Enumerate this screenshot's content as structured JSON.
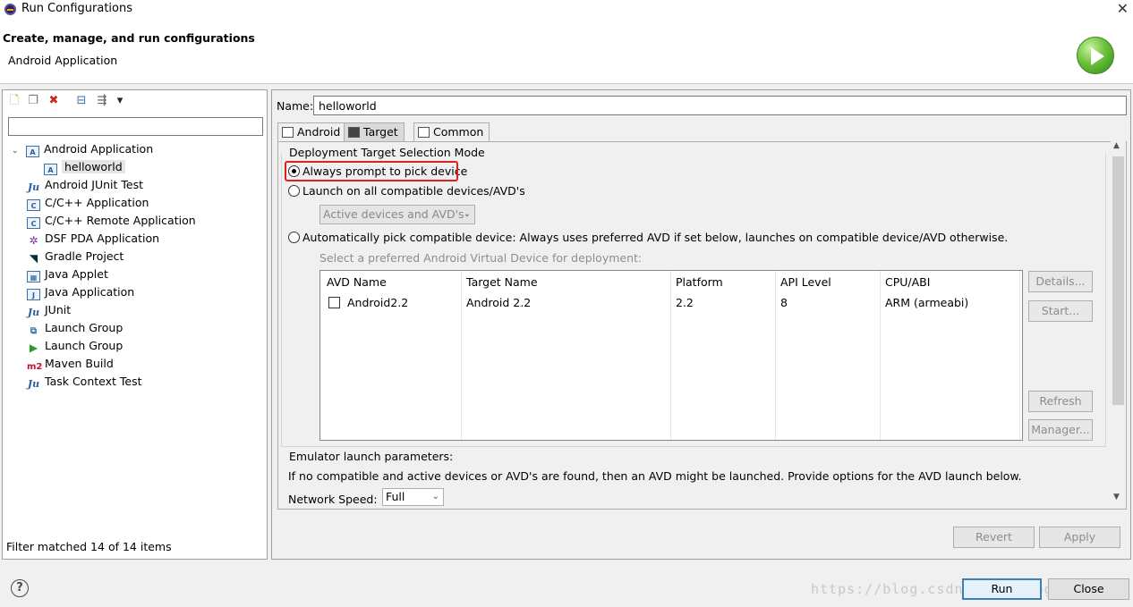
{
  "window": {
    "title": "Run Configurations",
    "close_glyph": "✕"
  },
  "header": {
    "title": "Create, manage, and run configurations",
    "subtitle": "Android Application"
  },
  "left": {
    "toolbar": [
      {
        "name": "new-config-icon",
        "glyph": "🗋"
      },
      {
        "name": "duplicate-icon",
        "glyph": "❐"
      },
      {
        "name": "delete-icon",
        "glyph": "✖"
      },
      {
        "name": "collapse-all-icon",
        "glyph": "⊟"
      },
      {
        "name": "filter-icon",
        "glyph": "⇶"
      },
      {
        "name": "dropdown-icon",
        "glyph": "▾"
      }
    ],
    "filter_value": "",
    "tree": [
      {
        "label": "Android Application",
        "icon": "app",
        "expanded": true
      },
      {
        "label": "helloworld",
        "icon": "app",
        "child": true,
        "selected": true
      },
      {
        "label": "Android JUnit Test",
        "icon": "junit"
      },
      {
        "label": "C/C++ Application",
        "icon": "c"
      },
      {
        "label": "C/C++ Remote Application",
        "icon": "c"
      },
      {
        "label": "DSF PDA Application",
        "icon": "dsf"
      },
      {
        "label": "Gradle Project",
        "icon": "gradle"
      },
      {
        "label": "Java Applet",
        "icon": "applet"
      },
      {
        "label": "Java Application",
        "icon": "java"
      },
      {
        "label": "JUnit",
        "icon": "junit"
      },
      {
        "label": "Launch Group",
        "icon": "launch"
      },
      {
        "label": "Launch Group",
        "icon": "launch-green"
      },
      {
        "label": "Maven Build",
        "icon": "m2"
      },
      {
        "label": "Task Context Test",
        "icon": "junit"
      }
    ],
    "status": "Filter matched 14 of 14 items"
  },
  "right": {
    "name_label": "Name:",
    "name_value": "helloworld",
    "tabs": [
      {
        "label": "Android",
        "active": false
      },
      {
        "label": "Target",
        "active": true
      },
      {
        "label": "Common",
        "active": false
      }
    ],
    "deployment": {
      "title": "Deployment Target Selection Mode",
      "opt_prompt": "Always prompt to pick device",
      "opt_all": "Launch on all compatible devices/AVD's",
      "combo_value": "Active devices and AVD's",
      "opt_auto": "Automatically pick compatible device: Always uses preferred AVD if set below, launches on compatible device/AVD otherwise.",
      "avd_hint": "Select a preferred Android Virtual Device for deployment:",
      "selected": "prompt"
    },
    "avd_table": {
      "headers": [
        "AVD Name",
        "Target Name",
        "Platform",
        "API Level",
        "CPU/ABI"
      ],
      "rows": [
        [
          "Android2.2",
          "Android 2.2",
          "2.2",
          "8",
          "ARM (armeabi)"
        ]
      ]
    },
    "side_buttons": {
      "details": "Details...",
      "start": "Start...",
      "refresh": "Refresh",
      "manager": "Manager..."
    },
    "emulator": {
      "title": "Emulator launch parameters:",
      "desc": "If no compatible and active devices or AVD's are found, then an AVD might be launched. Provide options for the AVD launch below.",
      "speed_label": "Network Speed:",
      "speed_value": "Full"
    },
    "revert": "Revert",
    "apply": "Apply"
  },
  "footer": {
    "run": "Run",
    "close": "Close",
    "help": "?",
    "watermark": "https://blog.csdn.net/zhangxuebo"
  }
}
